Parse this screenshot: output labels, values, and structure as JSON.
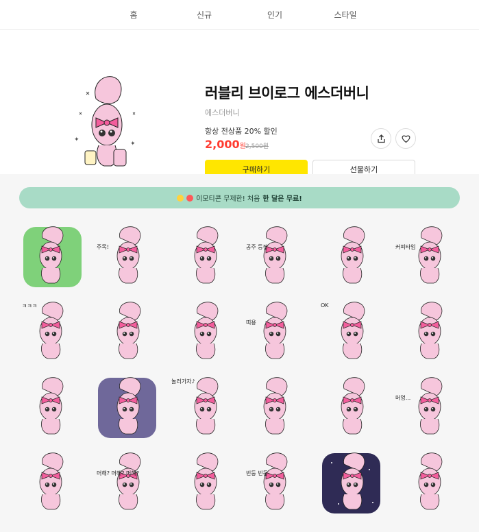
{
  "nav": {
    "items": [
      "홈",
      "신규",
      "인기",
      "스타일"
    ]
  },
  "product": {
    "title": "러블리 브이로그 에스더버니",
    "author": "에스더버니",
    "discount_text": "항상 전상품 20% 할인",
    "price": "2,000",
    "price_unit": "원",
    "original_price": "2,500원",
    "buy_label": "구매하기",
    "gift_label": "선물하기"
  },
  "banner": {
    "text_before": "이모티콘 무제한! 처음 ",
    "text_bold": "한 달은 무료!"
  },
  "stickers": [
    {
      "name": "sticker-1",
      "bg": "green",
      "caption": ""
    },
    {
      "name": "sticker-2",
      "bg": "none",
      "caption": "주목!"
    },
    {
      "name": "sticker-3",
      "bg": "none",
      "caption": ""
    },
    {
      "name": "sticker-4",
      "bg": "none",
      "caption": "공주   등장"
    },
    {
      "name": "sticker-5",
      "bg": "none",
      "caption": ""
    },
    {
      "name": "sticker-6",
      "bg": "none",
      "caption": "커피타임"
    },
    {
      "name": "sticker-7",
      "bg": "none",
      "caption": "ㅋㅋㅋ"
    },
    {
      "name": "sticker-8",
      "bg": "none",
      "caption": ""
    },
    {
      "name": "sticker-9",
      "bg": "none",
      "caption": ""
    },
    {
      "name": "sticker-10",
      "bg": "none",
      "caption": "띠용"
    },
    {
      "name": "sticker-11",
      "bg": "none",
      "caption": "OK"
    },
    {
      "name": "sticker-12",
      "bg": "none",
      "caption": ""
    },
    {
      "name": "sticker-13",
      "bg": "none",
      "caption": ""
    },
    {
      "name": "sticker-14",
      "bg": "purple",
      "caption": ""
    },
    {
      "name": "sticker-15",
      "bg": "none",
      "caption": "놀러가자♪"
    },
    {
      "name": "sticker-16",
      "bg": "none",
      "caption": ""
    },
    {
      "name": "sticker-17",
      "bg": "none",
      "caption": ""
    },
    {
      "name": "sticker-18",
      "bg": "none",
      "caption": "머엉..."
    },
    {
      "name": "sticker-19",
      "bg": "none",
      "caption": ""
    },
    {
      "name": "sticker-20",
      "bg": "none",
      "caption": "머해? 머해? 머해?"
    },
    {
      "name": "sticker-21",
      "bg": "none",
      "caption": ""
    },
    {
      "name": "sticker-22",
      "bg": "none",
      "caption": "빈둥 빈둥"
    },
    {
      "name": "sticker-23",
      "bg": "navy",
      "caption": ""
    },
    {
      "name": "sticker-24",
      "bg": "none",
      "caption": ""
    }
  ],
  "colors": {
    "buy": "#ffe600",
    "price": "#ff3b30",
    "banner": "#a8dbc6",
    "bunny": "#f6c6dc",
    "bow": "#f35d9c"
  }
}
